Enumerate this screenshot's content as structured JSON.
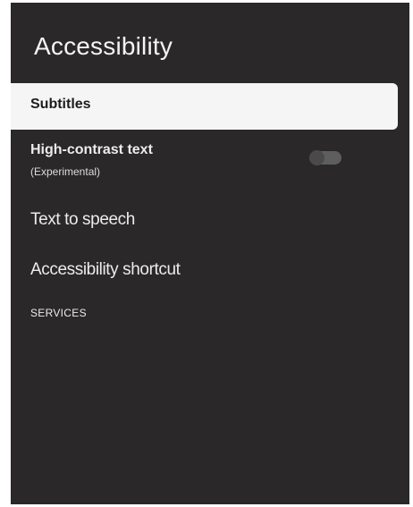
{
  "page": {
    "title": "Accessibility"
  },
  "items": [
    {
      "label": "Subtitles",
      "selected": true
    },
    {
      "label": "High-contrast text",
      "sublabel": "(Experimental)",
      "toggle": "off"
    },
    {
      "label": "Text to speech"
    },
    {
      "label": "Accessibility shortcut"
    }
  ],
  "section": {
    "header": "SERVICES"
  },
  "colors": {
    "panel_background": "#2a2828",
    "selected_background": "#f5f5f5",
    "text_primary": "#ececec",
    "toggle_off": "#5e5e5e"
  },
  "icons": {
    "toggle": "toggle-switch-icon"
  }
}
